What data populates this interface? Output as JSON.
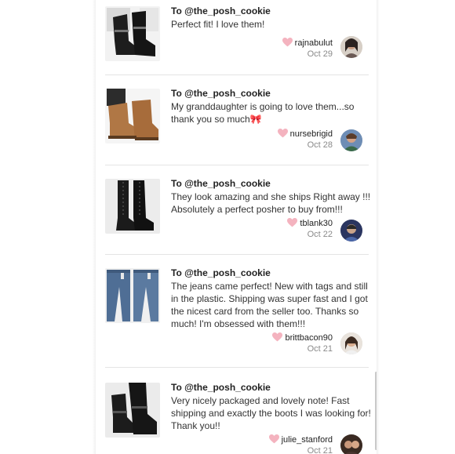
{
  "reviews": [
    {
      "to": "To @the_posh_cookie",
      "message": "Perfect fit! I love them!",
      "username": "rajnabulut",
      "date": "Oct 29",
      "product_icon": "boots-icon",
      "heart_color": "#f4b3bf"
    },
    {
      "to": "To @the_posh_cookie",
      "message": "My granddaughter is going to love them...so thank you so much🎀",
      "username": "nursebrigid",
      "date": "Oct 28",
      "product_icon": "ugg-boots-icon",
      "heart_color": "#f4b3bf"
    },
    {
      "to": "To @the_posh_cookie",
      "message": "They look amazing and she ships Right away !!! Absolutely a perfect posher to buy from!!!",
      "username": "tblank30",
      "date": "Oct 22",
      "product_icon": "tall-boots-icon",
      "heart_color": "#f4b3bf"
    },
    {
      "to": "To @the_posh_cookie",
      "message": "The jeans came perfect! New with tags and still in the plastic. Shipping was super fast and I got the nicest card from the seller too. Thanks so much! I'm obsessed with them!!!",
      "username": "brittbacon90",
      "date": "Oct 21",
      "product_icon": "jeans-icon",
      "heart_color": "#f4b3bf"
    },
    {
      "to": "To @the_posh_cookie",
      "message": "Very nicely packaged and lovely note! Fast shipping and exactly the boots I was looking for! Thank you!!",
      "username": "julie_stanford",
      "date": "Oct 21",
      "product_icon": "boots-icon",
      "heart_color": "#f4b3bf"
    }
  ]
}
